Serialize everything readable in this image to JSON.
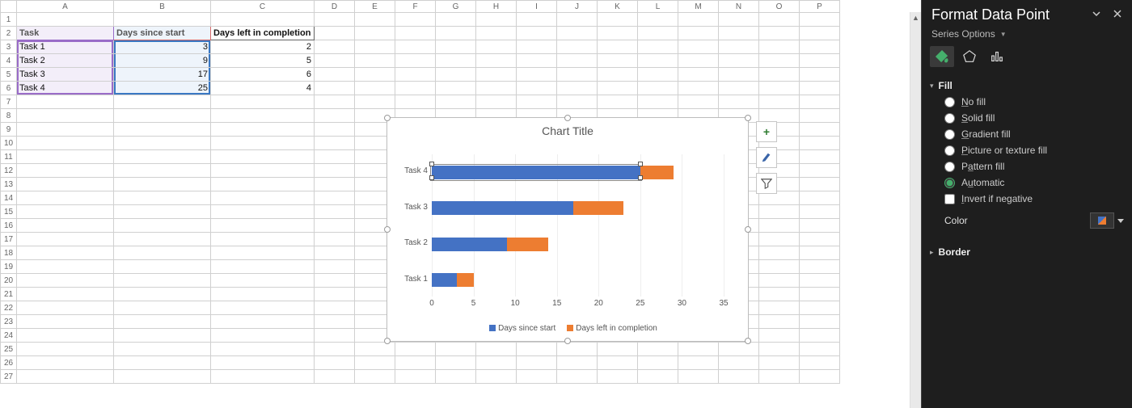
{
  "columns": [
    "A",
    "B",
    "C",
    "D",
    "E",
    "F",
    "G",
    "H",
    "I",
    "J",
    "K",
    "L",
    "M",
    "N",
    "O",
    "P"
  ],
  "rowCount": 27,
  "headers": {
    "A": "Task",
    "B": "Days since start",
    "C": "Days left in completion"
  },
  "rows": [
    {
      "task": "Task 1",
      "start": 3,
      "left": 2
    },
    {
      "task": "Task 2",
      "start": 9,
      "left": 5
    },
    {
      "task": "Task 3",
      "start": 17,
      "left": 6
    },
    {
      "task": "Task 4",
      "start": 25,
      "left": 4
    }
  ],
  "chart_data": {
    "type": "bar",
    "orientation": "horizontal",
    "stacked": true,
    "title": "Chart Title",
    "categories": [
      "Task 4",
      "Task 3",
      "Task 2",
      "Task 1"
    ],
    "series": [
      {
        "name": "Days since start",
        "color": "#4472c4",
        "values": [
          25,
          17,
          9,
          3
        ]
      },
      {
        "name": "Days left in completion",
        "color": "#ed7d31",
        "values": [
          4,
          6,
          5,
          2
        ]
      }
    ],
    "x_ticks": [
      0,
      5,
      10,
      15,
      20,
      25,
      30,
      35
    ],
    "xlim": [
      0,
      35
    ],
    "selected": {
      "series": 0,
      "point": 0
    }
  },
  "chart_buttons": {
    "add": "+",
    "brush": "brush-icon",
    "filter": "filter-icon"
  },
  "pane": {
    "title": "Format Data Point",
    "subtitle": "Series Options",
    "sections": {
      "fill": {
        "label": "Fill",
        "expanded": true,
        "options": [
          {
            "key": "none",
            "label": "No fill",
            "hot": "N"
          },
          {
            "key": "solid",
            "label": "Solid fill",
            "hot": "S"
          },
          {
            "key": "grad",
            "label": "Gradient fill",
            "hot": "G"
          },
          {
            "key": "pic",
            "label": "Picture or texture fill",
            "hot": "P"
          },
          {
            "key": "pat",
            "label": "Pattern fill",
            "hot": "a"
          },
          {
            "key": "auto",
            "label": "Automatic",
            "hot": "u"
          }
        ],
        "selected": "auto",
        "invert_label": "Invert if negative",
        "invert_hot": "I",
        "invert_checked": false,
        "color_label": "Color",
        "color_hot": "C"
      },
      "border": {
        "label": "Border",
        "expanded": false
      }
    }
  }
}
